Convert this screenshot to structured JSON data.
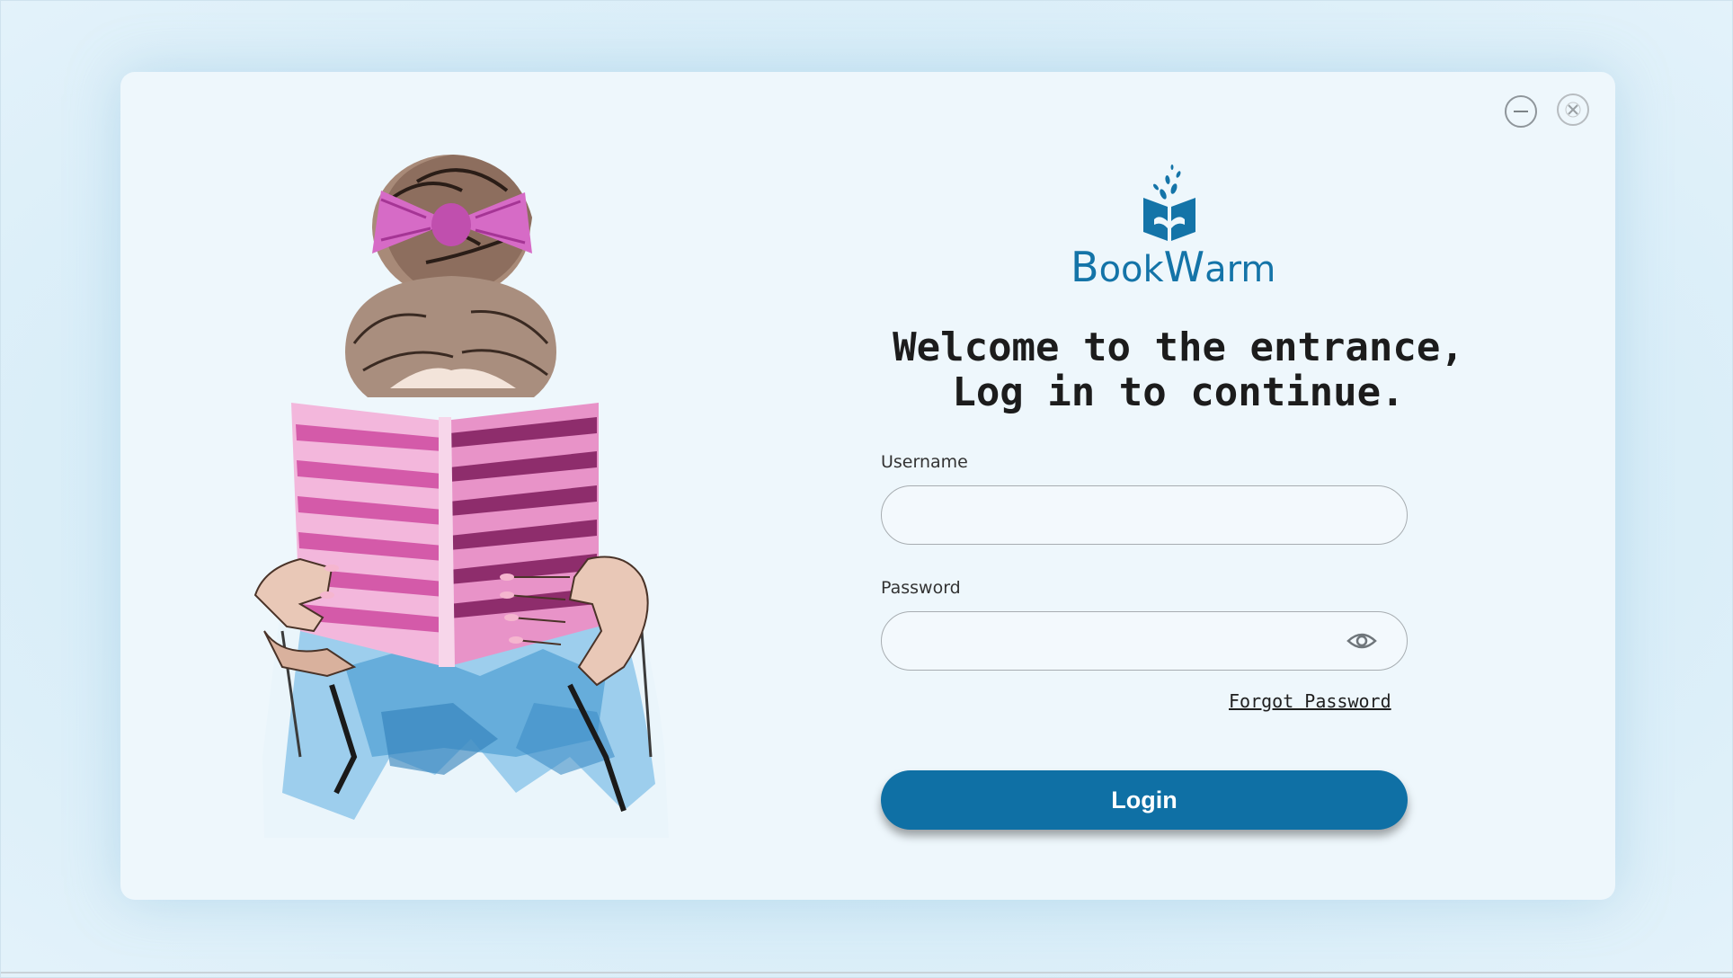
{
  "window": {
    "minimize_icon": "minimize-circle-icon",
    "close_icon": "close-circle-icon"
  },
  "brand": {
    "name_parts": [
      "B",
      "ook",
      "W",
      "arm"
    ],
    "logo_icon": "open-book-with-leaves-icon",
    "color": "#1474a8"
  },
  "headline": {
    "line1": "Welcome to the entrance,",
    "line2": "Log in to continue."
  },
  "form": {
    "username_label": "Username",
    "username_value": "",
    "password_label": "Password",
    "password_value": "",
    "password_toggle_icon": "eye-icon",
    "forgot_password": "Forgot Password",
    "login_button": "Login"
  },
  "illustration": {
    "icon": "girl-reading-book-illustration"
  },
  "colors": {
    "background": "#d6ecf7",
    "card": "#eef7fc",
    "primary": "#0f70a5",
    "text": "#1c1c1c"
  }
}
